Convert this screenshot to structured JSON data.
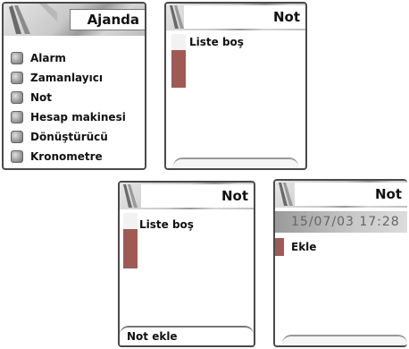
{
  "screens": {
    "ajanda": {
      "title": "Ajanda",
      "items": [
        {
          "label": "Alarm",
          "icon": "number-1-icon"
        },
        {
          "label": "Zamanlayıcı",
          "icon": "number-2-icon"
        },
        {
          "label": "Not",
          "icon": "number-3-icon"
        },
        {
          "label": "Hesap makinesi",
          "icon": "number-4-icon"
        },
        {
          "label": "Dönüştürücü",
          "icon": "number-5-icon"
        },
        {
          "label": "Kronometre",
          "icon": "number-6-icon"
        }
      ]
    },
    "not_empty": {
      "title": "Not",
      "message": "Liste boş"
    },
    "not_add": {
      "title": "Not",
      "message": "Liste boş",
      "softkey": "Not ekle"
    },
    "not_entry": {
      "title": "Not",
      "date": "15/07/03 17:28",
      "item": "Ekle"
    }
  },
  "colors": {
    "accent_scroll": "#a05a55",
    "border": "#4a4a4a"
  }
}
